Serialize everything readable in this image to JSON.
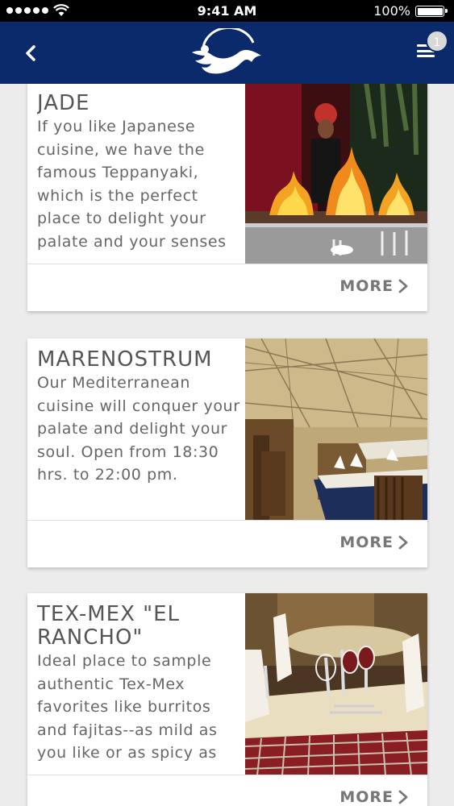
{
  "status_bar": {
    "time": "9:41 AM",
    "battery": "100%"
  },
  "navbar": {
    "back_icon": "chevron-left-icon",
    "logo": "mermaid-logo",
    "menu_icon": "hamburger-menu-icon",
    "menu_badge": "1"
  },
  "restaurants": [
    {
      "title": "JADE",
      "description": "If you like Japanese cuisine, we have the famous Teppanyaki, which is the perfect place to delight your palate and your senses",
      "more_label": "MORE"
    },
    {
      "title": "MARENOSTRUM",
      "description": "Our Mediterranean cuisine will conquer your palate and delight your soul. Open from 18:30 hrs. to 22:00 pm.",
      "more_label": "MORE"
    },
    {
      "title": "TEX-MEX \"EL RANCHO\"",
      "description": "Ideal place to sample authentic Tex-Mex favorites like burritos and fajitas--as mild as you like or as spicy as",
      "more_label": "MORE"
    }
  ],
  "colors": {
    "navbar": "#0a2a6b",
    "background": "#ececec",
    "text": "#666666"
  }
}
